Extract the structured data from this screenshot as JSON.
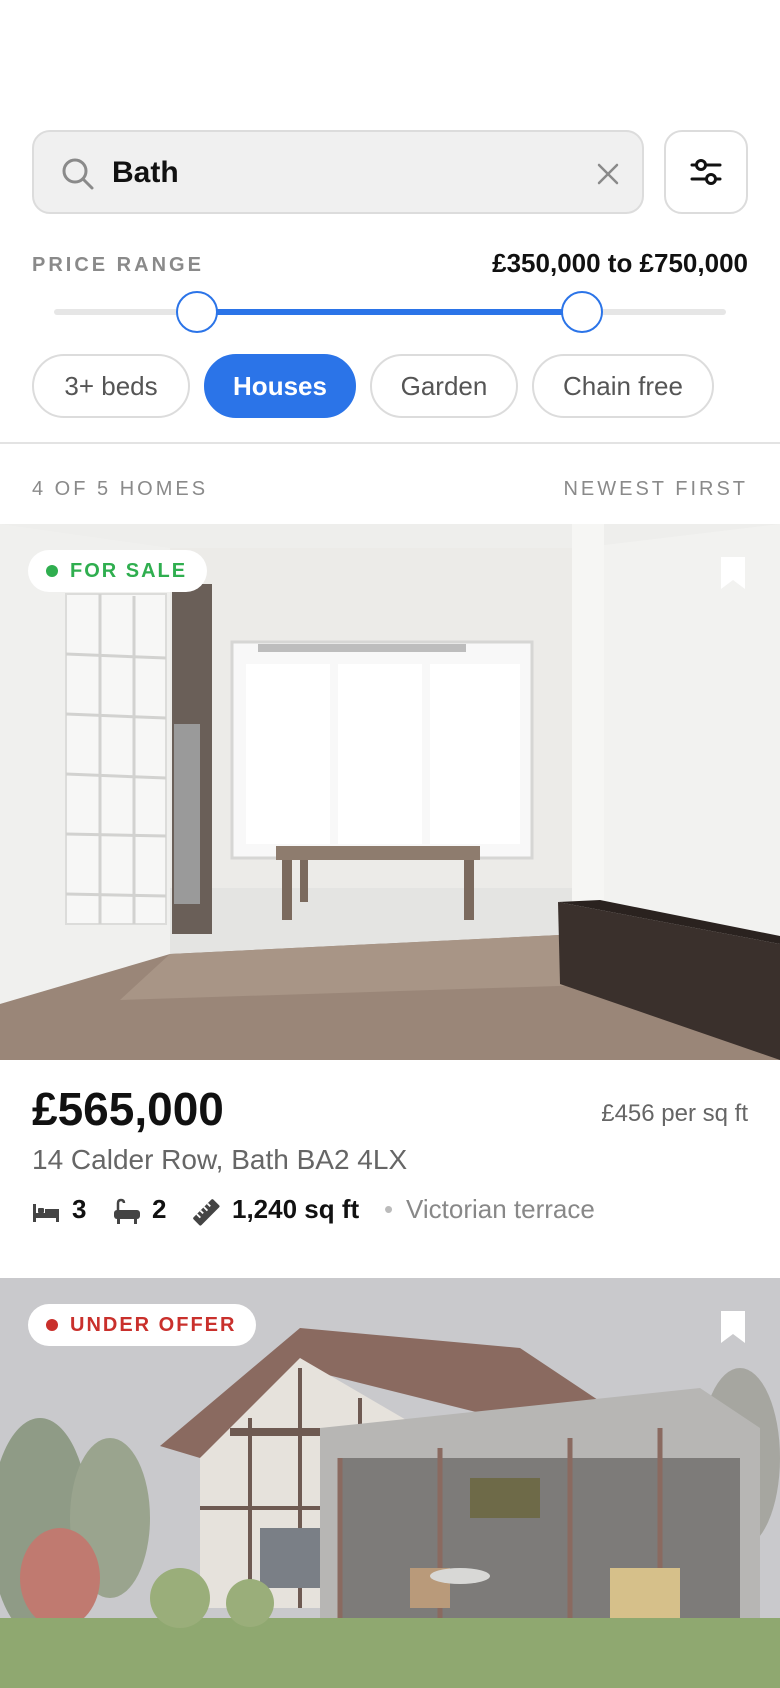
{
  "search": {
    "value": "Bath",
    "icon": "search-icon",
    "clear_icon": "close-icon",
    "filter_icon": "sliders-icon"
  },
  "price_range": {
    "label": "PRICE RANGE",
    "display": "£350,000 to £750,000",
    "min_value": 350000,
    "max_value": 750000,
    "accent_color": "#2b74e8"
  },
  "chips": [
    {
      "label": "3+ beds",
      "active": false
    },
    {
      "label": "Houses",
      "active": true
    },
    {
      "label": "Garden",
      "active": false
    },
    {
      "label": "Chain free",
      "active": false
    }
  ],
  "results": {
    "count_label": "4 OF 5 HOMES",
    "sort_label": "NEWEST FIRST"
  },
  "listings": [
    {
      "status": "FOR SALE",
      "status_color": "#2fae4f",
      "bookmark_icon": "bookmark-icon",
      "price": "£565,000",
      "price_per_sqft": "£456 per sq ft",
      "address": "14 Calder Row, Bath BA2 4LX",
      "beds": "3",
      "baths": "2",
      "area": "1,240 sq ft",
      "property_type": "Victorian terrace"
    },
    {
      "status": "UNDER OFFER",
      "status_color": "#c9302c",
      "bookmark_icon": "bookmark-icon"
    }
  ]
}
